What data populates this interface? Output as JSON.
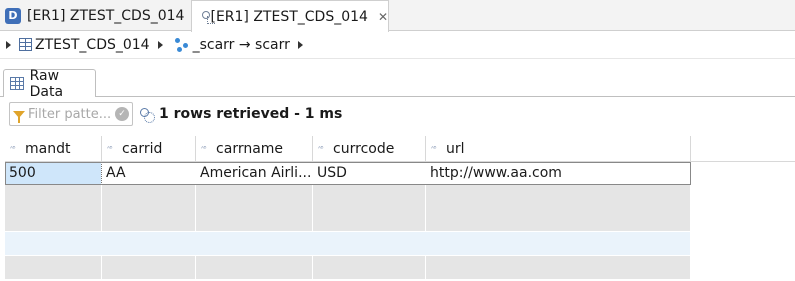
{
  "editor_tabs": [
    {
      "label": "[ER1] ZTEST_CDS_014",
      "icon": "ddic-d-icon",
      "active": false
    },
    {
      "label": "[ER1] ZTEST_CDS_014",
      "icon": "cds-view-icon",
      "active": true,
      "close": "✕"
    }
  ],
  "breadcrumb": {
    "entity": "ZTEST_CDS_014",
    "association": "_scarr → scarr"
  },
  "panel_tab": {
    "label": "Raw Data",
    "icon": "table-grid-icon"
  },
  "filter": {
    "placeholder": "Filter patte...",
    "status": "1 rows retrieved - 1 ms"
  },
  "table": {
    "columns": [
      "mandt",
      "carrid",
      "carrname",
      "currcode",
      "url"
    ],
    "column_type_icon": "text-type-icon",
    "rows": [
      {
        "mandt": "500",
        "carrid": "AA",
        "carrname": "American Airli...",
        "currcode": "USD",
        "url": "http://www.aa.com"
      }
    ]
  },
  "colors": {
    "selection": "#cfe6fa",
    "empty_row": "#e5e5e5",
    "highlight_row": "#eaf3fb"
  }
}
